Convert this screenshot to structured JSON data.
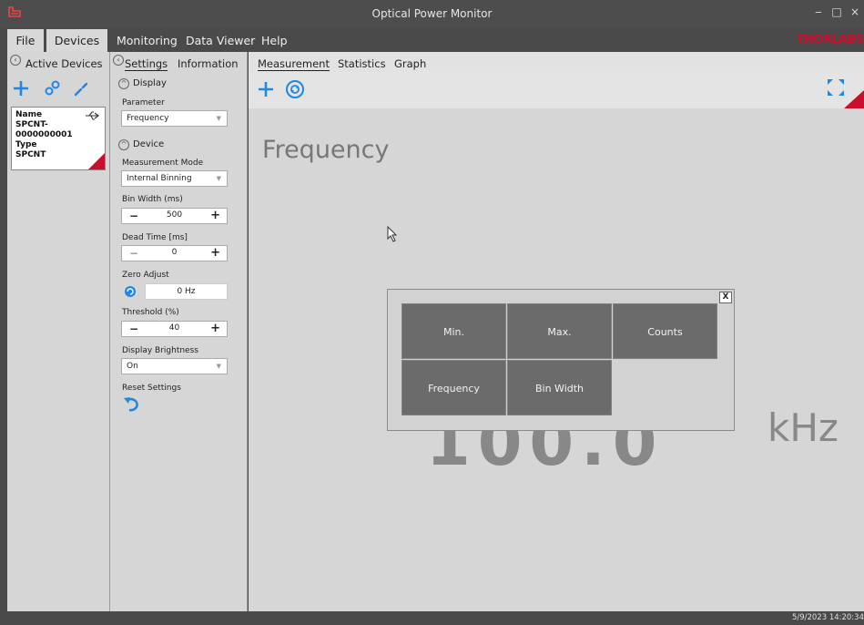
{
  "window": {
    "title": "Optical Power Monitor",
    "minimize": "‒",
    "maximize": "□",
    "close": "×"
  },
  "menu": {
    "items": [
      "File",
      "Devices",
      "Monitoring",
      "Data Viewer",
      "Help"
    ],
    "brand": "THORLABS"
  },
  "active_devices": {
    "header": "Active Devices",
    "device": {
      "name_label": "Name",
      "name": "SPCNT-0000000001",
      "type_label": "Type",
      "type": "SPCNT"
    }
  },
  "settings_panel": {
    "tabs": [
      "Settings",
      "Information"
    ],
    "display_section": "Display",
    "parameter_label": "Parameter",
    "parameter_value": "Frequency",
    "device_section": "Device",
    "measurement_mode_label": "Measurement Mode",
    "measurement_mode_value": "Internal Binning",
    "bin_width_label": "Bin Width (ms)",
    "bin_width_value": "500",
    "dead_time_label": "Dead Time [ms]",
    "dead_time_value": "0",
    "zero_adjust_label": "Zero Adjust",
    "zero_adjust_value": "0 Hz",
    "threshold_label": "Threshold (%)",
    "threshold_value": "40",
    "display_brightness_label": "Display Brightness",
    "display_brightness_value": "On",
    "reset_settings_label": "Reset Settings",
    "minus": "−",
    "plus": "+"
  },
  "main": {
    "tabs": [
      "Measurement",
      "Statistics",
      "Graph"
    ],
    "parameter_title": "Frequency",
    "unit": "kHz",
    "value_fragment": "100.0"
  },
  "overlay": {
    "close": "X",
    "tiles": [
      "Min.",
      "Max.",
      "Counts",
      "Frequency",
      "Bin Width"
    ]
  },
  "status": {
    "datetime": "5/9/2023 14:20:34"
  },
  "colors": {
    "accent_blue": "#1e88e5",
    "brand_red": "#c8102e",
    "tile_gray": "#6b6b6b"
  }
}
